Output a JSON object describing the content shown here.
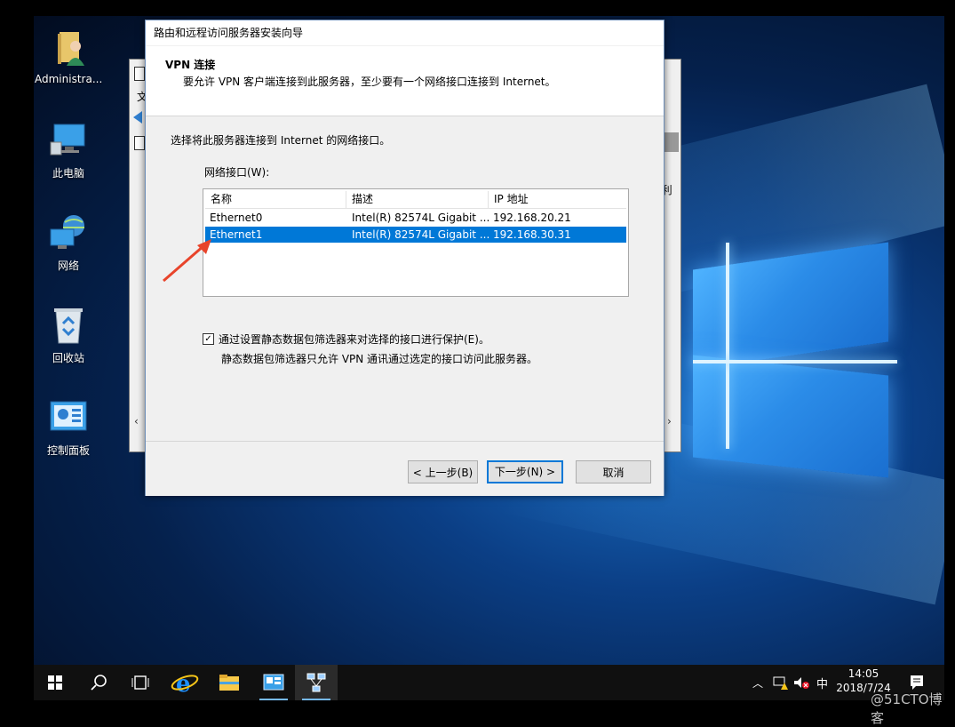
{
  "desktop": {
    "icons": [
      {
        "label": "Administra..."
      },
      {
        "label": "此电脑"
      },
      {
        "label": "网络"
      },
      {
        "label": "回收站"
      },
      {
        "label": "控制面板"
      }
    ]
  },
  "background_window": {
    "partial_text": {
      "t1": "文",
      "t2": "(利"
    }
  },
  "wizard": {
    "title": "路由和远程访问服务器安装向导",
    "heading": "VPN 连接",
    "subheading": "要允许 VPN 客户端连接到此服务器，至少要有一个网络接口连接到 Internet。",
    "instruction": "选择将此服务器连接到 Internet 的网络接口。",
    "list_label": "网络接口(W):",
    "columns": [
      "名称",
      "描述",
      "IP 地址"
    ],
    "rows": [
      {
        "name": "Ethernet0",
        "desc": "Intel(R) 82574L Gigabit ...",
        "ip": "192.168.20.21",
        "selected": false
      },
      {
        "name": "Ethernet1",
        "desc": "Intel(R) 82574L Gigabit ...",
        "ip": "192.168.30.31",
        "selected": true
      }
    ],
    "checkbox": {
      "label": "通过设置静态数据包筛选器来对选择的接口进行保护(E)。",
      "checked": true
    },
    "checkbox_hint": "静态数据包筛选器只允许 VPN 通讯通过选定的接口访问此服务器。",
    "buttons": {
      "back": "< 上一步(B)",
      "next": "下一步(N) >",
      "cancel": "取消"
    }
  },
  "taskbar": {
    "tray": {
      "ime": "中"
    },
    "clock": {
      "time": "14:05",
      "date": "2018/7/24"
    }
  },
  "watermark": "@51CTO博客",
  "colors": {
    "selection": "#0078d7",
    "arrow": "#e8442b",
    "default_button_border": "#0078d7"
  }
}
